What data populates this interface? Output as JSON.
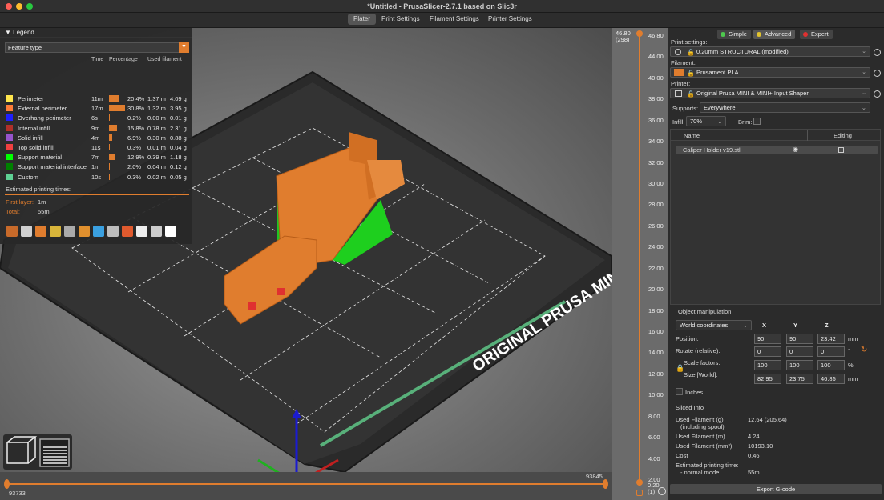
{
  "window": {
    "title": "*Untitled - PrusaSlicer-2.7.1 based on Slic3r",
    "traffic_colors": [
      "#fe5f57",
      "#febc2e",
      "#28c840"
    ]
  },
  "tabs": [
    "Plater",
    "Print Settings",
    "Filament Settings",
    "Printer Settings"
  ],
  "legend": {
    "title": "Legend",
    "view_type": "Feature type",
    "headers": {
      "time": "Time",
      "percentage": "Percentage",
      "filament": "Used filament"
    },
    "rows": [
      {
        "name": "Perimeter",
        "color": "#ffe64d",
        "time": "11m",
        "pct_value": 20.4,
        "pct": "20.4%",
        "m": "1.37 m",
        "g": "4.09 g"
      },
      {
        "name": "External perimeter",
        "color": "#ff7d38",
        "time": "17m",
        "pct_value": 30.8,
        "pct": "30.8%",
        "m": "1.32 m",
        "g": "3.95 g"
      },
      {
        "name": "Overhang perimeter",
        "color": "#1f1fff",
        "time": "6s",
        "pct_value": 0.2,
        "pct": "0.2%",
        "m": "0.00 m",
        "g": "0.01 g"
      },
      {
        "name": "Internal infill",
        "color": "#b03029",
        "time": "9m",
        "pct_value": 15.8,
        "pct": "15.8%",
        "m": "0.78 m",
        "g": "2.31 g"
      },
      {
        "name": "Solid infill",
        "color": "#9654cc",
        "time": "4m",
        "pct_value": 6.9,
        "pct": "6.9%",
        "m": "0.30 m",
        "g": "0.88 g"
      },
      {
        "name": "Top solid infill",
        "color": "#f04040",
        "time": "11s",
        "pct_value": 0.3,
        "pct": "0.3%",
        "m": "0.01 m",
        "g": "0.04 g"
      },
      {
        "name": "Support material",
        "color": "#00ff00",
        "time": "7m",
        "pct_value": 12.9,
        "pct": "12.9%",
        "m": "0.39 m",
        "g": "1.18 g"
      },
      {
        "name": "Support material interface",
        "color": "#008000",
        "time": "1m",
        "pct_value": 2.0,
        "pct": "2.0%",
        "m": "0.04 m",
        "g": "0.12 g"
      },
      {
        "name": "Custom",
        "color": "#5ed194",
        "time": "10s",
        "pct_value": 0.3,
        "pct": "0.3%",
        "m": "0.02 m",
        "g": "0.05 g"
      }
    ],
    "estimated_title": "Estimated printing times:",
    "first_layer_label": "First layer:",
    "first_layer_value": "1m",
    "total_label": "Total:",
    "total_value": "55m"
  },
  "bed_text": "ORIGINAL PRUSA MINI",
  "hslider": {
    "left_value": "93733",
    "right_value": "93845"
  },
  "vslider": {
    "top_value": "46.80",
    "top_layer": "(298)",
    "bottom_value": "0.20",
    "bottom_layer": "(1)",
    "ticks": [
      "46.80",
      "44.00",
      "40.00",
      "38.00",
      "36.00",
      "34.00",
      "32.00",
      "30.00",
      "28.00",
      "26.00",
      "24.00",
      "22.00",
      "20.00",
      "18.00",
      "16.00",
      "14.00",
      "12.00",
      "10.00",
      "8.00",
      "6.00",
      "4.00",
      "2.00"
    ]
  },
  "panel": {
    "modes": {
      "simple": "Simple",
      "advanced": "Advanced",
      "expert": "Expert"
    },
    "print_settings_label": "Print settings:",
    "print_settings_value": "0.20mm STRUCTURAL (modified)",
    "filament_label": "Filament:",
    "filament_value": "Prusament PLA",
    "filament_color": "#e07d2e",
    "printer_label": "Printer:",
    "printer_value": "Original Prusa MINI & MINI+ Input Shaper",
    "supports_label": "Supports:",
    "supports_value": "Everywhere",
    "infill_label": "Infill:",
    "infill_value": "70%",
    "brim_label": "Brim:",
    "objects": {
      "name_header": "Name",
      "editing_header": "Editing",
      "items": [
        {
          "name": "Caliper Holder v19.stl"
        }
      ]
    },
    "manip": {
      "title": "Object manipulation",
      "coord_system": "World coordinates",
      "x": "X",
      "y": "Y",
      "z": "Z",
      "position_label": "Position:",
      "position": [
        "90",
        "90",
        "23.42"
      ],
      "position_unit": "mm",
      "rotate_label": "Rotate (relative):",
      "rotate": [
        "0",
        "0",
        "0"
      ],
      "rotate_unit": "°",
      "scale_label": "Scale factors:",
      "scale": [
        "100",
        "100",
        "100"
      ],
      "scale_unit": "%",
      "size_label": "Size [World]:",
      "size": [
        "82.95",
        "23.75",
        "46.85"
      ],
      "size_unit": "mm",
      "inches_label": "Inches"
    },
    "sliced": {
      "title": "Sliced Info",
      "used_g_label": "Used Filament (g)",
      "used_g_sub": "(including spool)",
      "used_g_value": "12.64 (205.64)",
      "used_m_label": "Used Filament (m)",
      "used_m_value": "4.24",
      "used_mm3_label": "Used Filament (mm³)",
      "used_mm3_value": "10193.10",
      "cost_label": "Cost",
      "cost_value": "0.46",
      "est_label": "Estimated printing time:",
      "est_mode_label": "- normal mode",
      "est_mode_value": "55m"
    },
    "export_label": "Export G-code"
  }
}
